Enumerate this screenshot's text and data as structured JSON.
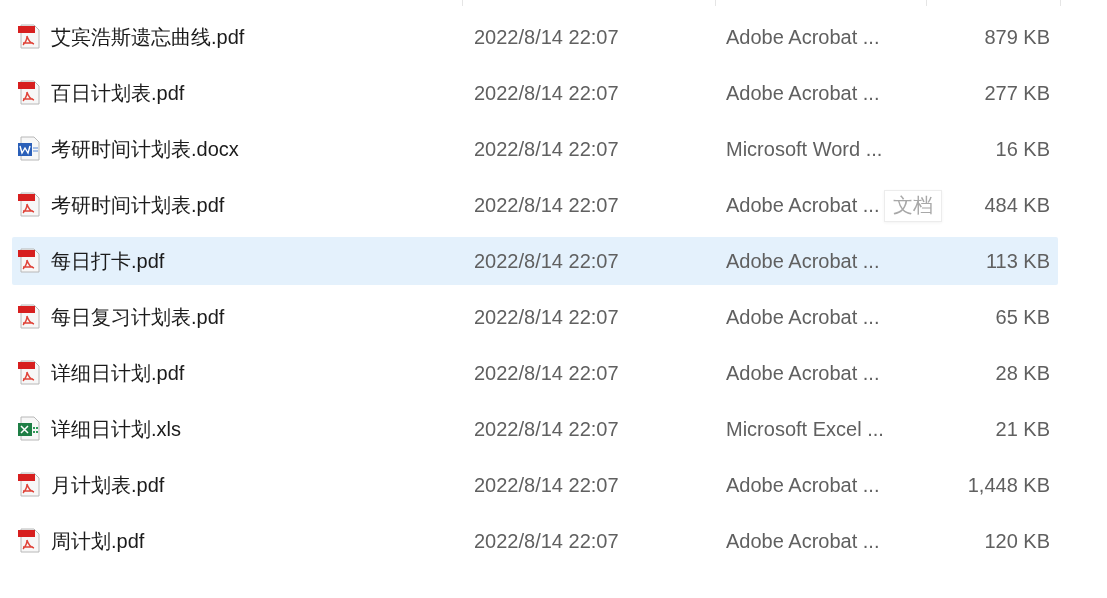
{
  "files": [
    {
      "kind": "pdf",
      "name": "艾宾浩斯遗忘曲线.pdf",
      "modified": "2022/8/14 22:07",
      "type": "Adobe Acrobat ...",
      "size": "879 KB",
      "selected": false
    },
    {
      "kind": "pdf",
      "name": "百日计划表.pdf",
      "modified": "2022/8/14 22:07",
      "type": "Adobe Acrobat ...",
      "size": "277 KB",
      "selected": false
    },
    {
      "kind": "word",
      "name": "考研时间计划表.docx",
      "modified": "2022/8/14 22:07",
      "type": "Microsoft Word ...",
      "size": "16 KB",
      "selected": false
    },
    {
      "kind": "pdf",
      "name": "考研时间计划表.pdf",
      "modified": "2022/8/14 22:07",
      "type": "Adobe Acrobat ...",
      "size": "484 KB",
      "selected": false
    },
    {
      "kind": "pdf",
      "name": "每日打卡.pdf",
      "modified": "2022/8/14 22:07",
      "type": "Adobe Acrobat ...",
      "size": "113 KB",
      "selected": true
    },
    {
      "kind": "pdf",
      "name": "每日复习计划表.pdf",
      "modified": "2022/8/14 22:07",
      "type": "Adobe Acrobat ...",
      "size": "65 KB",
      "selected": false
    },
    {
      "kind": "pdf",
      "name": "详细日计划.pdf",
      "modified": "2022/8/14 22:07",
      "type": "Adobe Acrobat ...",
      "size": "28 KB",
      "selected": false
    },
    {
      "kind": "excel",
      "name": "详细日计划.xls",
      "modified": "2022/8/14 22:07",
      "type": "Microsoft Excel ...",
      "size": "21 KB",
      "selected": false
    },
    {
      "kind": "pdf",
      "name": "月计划表.pdf",
      "modified": "2022/8/14 22:07",
      "type": "Adobe Acrobat ...",
      "size": "1,448 KB",
      "selected": false
    },
    {
      "kind": "pdf",
      "name": "周计划.pdf",
      "modified": "2022/8/14 22:07",
      "type": "Adobe Acrobat ...",
      "size": "120 KB",
      "selected": false
    }
  ],
  "tooltip": {
    "text": "文档"
  }
}
